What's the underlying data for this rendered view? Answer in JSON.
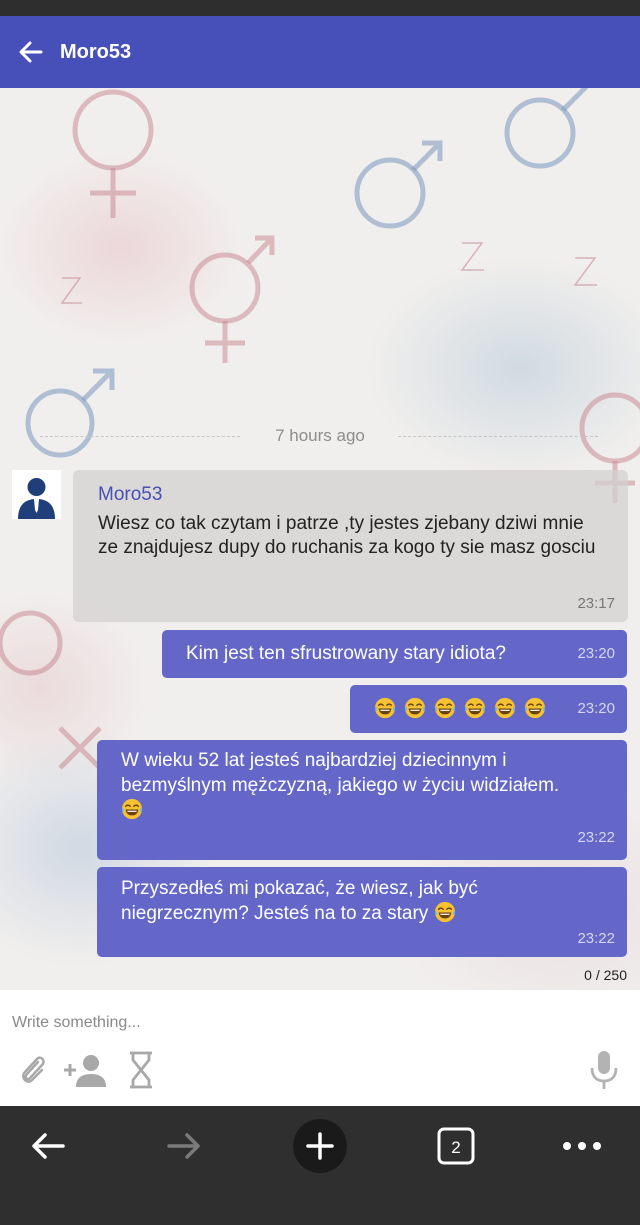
{
  "header": {
    "title": "Moro53"
  },
  "divider": {
    "label": "7 hours ago"
  },
  "messages": {
    "m1": {
      "sender": "Moro53",
      "text": "Wiesz co tak czytam i patrze ,ty jestes zjebany dziwi mnie ze znajdujesz dupy do ruchanis za kogo ty sie masz gosciu",
      "time": "23:17"
    },
    "m2": {
      "text": "Kim jest ten sfrustrowany stary idiota?",
      "time": "23:20"
    },
    "m3": {
      "emoji_count": 6,
      "time": "23:20"
    },
    "m4": {
      "text_line1": "W wieku 52 lat jesteś najbardziej dziecinnym i",
      "text_line2": "bezmyślnym mężczyzną, jakiego w życiu widziałem.",
      "time": "23:22"
    },
    "m5": {
      "text_line1": "Przyszedłeś mi pokazać, że wiesz, jak być",
      "text_line2": "niegrzecznym? Jesteś na to za stary",
      "time": "23:22"
    }
  },
  "compose": {
    "counter": "0 / 250",
    "placeholder": "Write something..."
  },
  "navbar": {
    "tab_count": "2"
  },
  "icons": {
    "back": "arrow-left-icon",
    "avatar": "person-avatar-icon",
    "attach": "paperclip-icon",
    "add_user": "person-add-icon",
    "timer": "hourglass-icon",
    "mic": "microphone-icon",
    "nav_back": "arrow-left-icon",
    "nav_forward": "arrow-right-icon",
    "nav_new": "plus-icon",
    "nav_tabs": "tabs-icon",
    "nav_menu": "more-dots-icon",
    "laugh": "laughing-emoji-icon"
  },
  "colors": {
    "accent": "#4650b8",
    "outgoing_bubble": "#6467c8",
    "incoming_bubble": "#d2d0ce",
    "navbar": "#2f2f2f"
  }
}
